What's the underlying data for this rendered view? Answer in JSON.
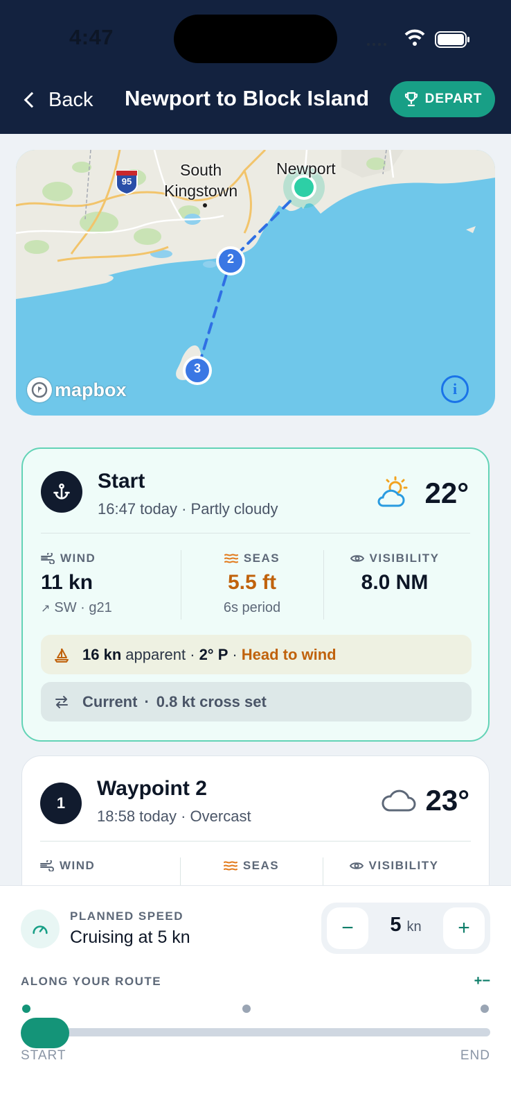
{
  "status": {
    "time": "4:47"
  },
  "nav": {
    "back_label": "Back",
    "title": "Newport to Block Island",
    "depart_label": "DEPART"
  },
  "map": {
    "labels": {
      "south_kingstown": "South\nKingstown",
      "newport": "Newport",
      "interstate": "95"
    },
    "waypoint_markers": [
      "2",
      "3"
    ],
    "attribution": "mapbox",
    "info_label": "i"
  },
  "start_card": {
    "title": "Start",
    "subtitle": "16:47 today · Partly cloudy",
    "temperature": "22°",
    "weather_icon": "partly-cloudy-icon",
    "wind": {
      "label": "WIND",
      "value": "11 kn",
      "sub": "SW · g21"
    },
    "seas": {
      "label": "SEAS",
      "value": "5.5 ft",
      "sub": "6s period"
    },
    "visibility": {
      "label": "VISIBILITY",
      "value": "8.0 NM"
    },
    "apparent": {
      "speed": "16 kn",
      "text": "apparent ·",
      "angle": "2° P",
      "sep": "·",
      "warning": "Head to wind"
    },
    "current": {
      "label": "Current",
      "sep": "·",
      "value": "0.8 kt cross set"
    }
  },
  "waypoint_card": {
    "badge": "1",
    "title": "Waypoint 2",
    "subtitle": "18:58 today · Overcast",
    "temperature": "23°",
    "weather_icon": "cloud-icon",
    "wind_label": "WIND",
    "seas_label": "SEAS",
    "visibility_label": "VISIBILITY"
  },
  "planner": {
    "speed_label": "PLANNED SPEED",
    "speed_text": "Cruising at 5 kn",
    "minus": "−",
    "plus": "+",
    "speed_value": "5",
    "speed_unit": "kn",
    "route_label": "ALONG YOUR ROUTE",
    "route_toggle": "+−",
    "start_label": "START",
    "end_label": "END",
    "progress": 0
  },
  "colors": {
    "header": "#13223f",
    "accent": "#189f86",
    "warning": "#c0620c"
  }
}
